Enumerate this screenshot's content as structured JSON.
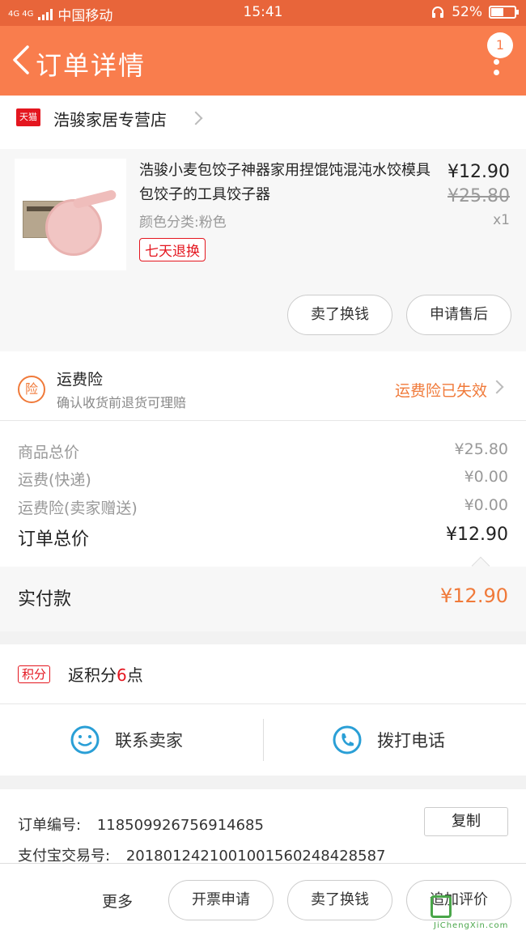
{
  "status_bar": {
    "network": "4G 4G",
    "carrier": "中国移动",
    "time": "15:41",
    "battery_percent": "52%",
    "battery_level": 0.52
  },
  "header": {
    "title": "订单详情",
    "badge_count": "1"
  },
  "shop": {
    "platform_badge": "天猫",
    "name": "浩骏家居专营店"
  },
  "product": {
    "name": "浩骏小麦包饺子神器家用捏馄饨混沌水饺模具包饺子的工具饺子器",
    "variant": "颜色分类:粉色",
    "tag": "七天退换",
    "price": "¥12.90",
    "original_price": "¥25.80",
    "quantity": "x1",
    "actions": [
      "卖了换钱",
      "申请售后"
    ]
  },
  "insurance": {
    "icon_text": "险",
    "title": "运费险",
    "subtitle": "确认收货前退货可理赔",
    "status": "运费险已失效"
  },
  "costs": [
    {
      "label": "商品总价",
      "value": "¥25.80"
    },
    {
      "label": "运费(快递)",
      "value": "¥0.00"
    },
    {
      "label": "运费险(卖家赠送)",
      "value": "¥0.00"
    }
  ],
  "total": {
    "label": "订单总价",
    "value": "¥12.90"
  },
  "paid": {
    "label": "实付款",
    "value": "¥12.90"
  },
  "points": {
    "badge": "积分",
    "prefix": "返积分",
    "amount": "6",
    "suffix": "点"
  },
  "contact": {
    "seller": "联系卖家",
    "phone": "拨打电话"
  },
  "order_info": {
    "order_no_label": "订单编号:",
    "order_no": "118509926756914685",
    "alipay_label": "支付宝交易号:",
    "alipay_no": "2018012421001001560248428587",
    "copy": "复制"
  },
  "bottom_bar": {
    "more": "更多",
    "buttons": [
      "开票申请",
      "卖了换钱",
      "追加评价"
    ]
  },
  "watermark": {
    "site": "JiChengXin.com"
  },
  "colors": {
    "header": "#f97d4d",
    "accent": "#f07a3a",
    "tmall_red": "#e4161f",
    "contact_blue": "#2a9fd6"
  }
}
